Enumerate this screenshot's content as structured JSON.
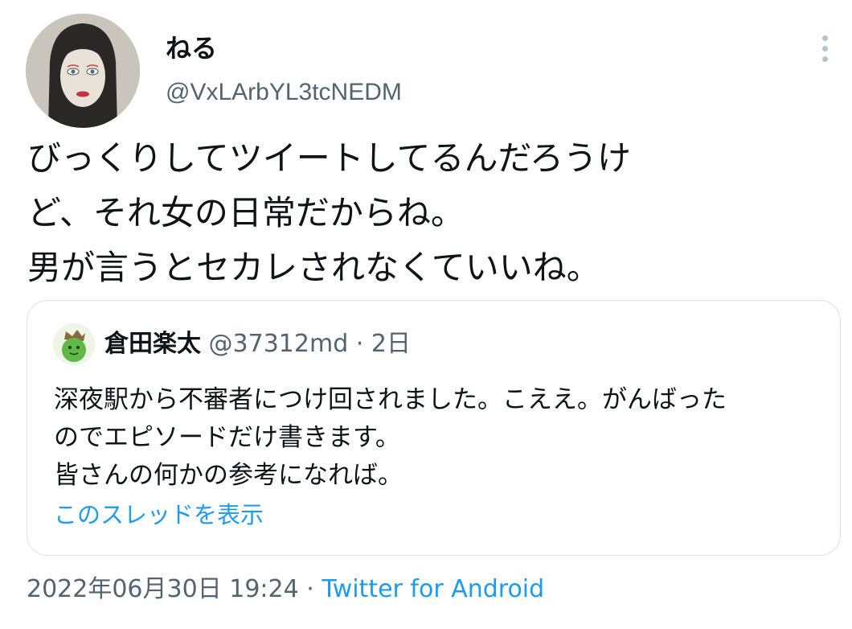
{
  "author": {
    "display_name": "ねる",
    "handle": "@VxLArbYL3tcNEDM",
    "avatar_icon": "portrait-drawing-avatar"
  },
  "more_icon": "more-vertical-icon",
  "tweet": {
    "lines": [
      "びっくりしてツイートしてるんだろうけ",
      "ど、それ女の日常だからね。",
      "男が言うとセカレされなくていいね。"
    ]
  },
  "quote": {
    "display_name": "倉田楽太",
    "handle": "@37312md",
    "separator": "·",
    "time": "2日",
    "avatar_icon": "green-character-avatar",
    "lines": [
      "深夜駅から不審者につけ回されました。こええ。がんばった",
      "のでエピソードだけ書きます。",
      "皆さんの何かの参考になれば。"
    ],
    "show_thread": "このスレッドを表示"
  },
  "meta": {
    "timestamp": "2022年06月30日 19:24",
    "separator": "·",
    "source": "Twitter for Android"
  },
  "colors": {
    "text": "#0f1419",
    "secondary": "#536471",
    "link": "#1d9bf0",
    "border": "#dde2e6"
  }
}
